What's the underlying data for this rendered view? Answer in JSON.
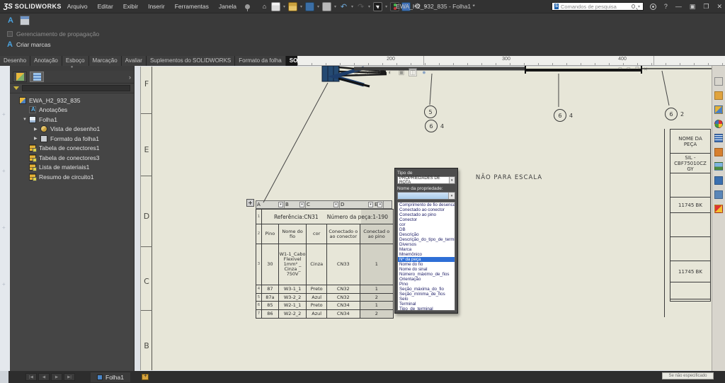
{
  "titlebar": {
    "logo_mark": "ƷS",
    "logo_word": "SOLIDWORKS",
    "menus": [
      "Arquivo",
      "Editar",
      "Exibir",
      "Inserir",
      "Ferramentas",
      "Janela"
    ],
    "title": "EWA_H2_932_835 - Folha1 *",
    "search_placeholder": "Comandos de pesquisa",
    "help_glyph": "?",
    "minimize_glyph": "—",
    "maximize_glyph": "▣",
    "cascade_glyph": "❐",
    "close_glyph": "✕"
  },
  "ribbon": {
    "toggle_label": "Gerenciamento de propagação",
    "command_label": "Criar marcas",
    "tabs": [
      {
        "label": "Desenho",
        "active": false
      },
      {
        "label": "Anotação",
        "active": false
      },
      {
        "label": "Esboço",
        "active": false
      },
      {
        "label": "Marcação",
        "active": false
      },
      {
        "label": "Avaliar",
        "active": false
      },
      {
        "label": "Suplementos do SOLIDWORKS",
        "active": false
      },
      {
        "label": "Formato da folha",
        "active": false
      },
      {
        "label": "SOLIDWORKS Electrical Drawing",
        "active": true
      }
    ]
  },
  "ruler": {
    "labels": [
      "200",
      "300",
      "400"
    ]
  },
  "panel": {
    "tree": [
      {
        "label": "EWA_H2_932_835",
        "icon": "drawing-doc-icon",
        "indent": 0,
        "arrow": ""
      },
      {
        "label": "Anotações",
        "icon": "annotations-icon",
        "indent": 1,
        "arrow": ""
      },
      {
        "label": "Folha1",
        "icon": "sheet-icon",
        "indent": 1,
        "arrow": "▼"
      },
      {
        "label": "Vista de desenho1",
        "icon": "drawing-view-icon",
        "indent": 2,
        "arrow": "▶"
      },
      {
        "label": "Formato da folha1",
        "icon": "sheet-format-icon",
        "indent": 2,
        "arrow": "▶"
      },
      {
        "label": "Tabela de conectores1",
        "icon": "table-icon",
        "indent": 1,
        "arrow": ""
      },
      {
        "label": "Tabela de conectores3",
        "icon": "table-icon",
        "indent": 1,
        "arrow": ""
      },
      {
        "label": "Lista de materiais1",
        "icon": "table-icon",
        "indent": 1,
        "arrow": ""
      },
      {
        "label": "Resumo de circuito1",
        "icon": "table-icon",
        "indent": 1,
        "arrow": ""
      }
    ]
  },
  "sheet": {
    "zones": [
      "F",
      "E",
      "D",
      "C",
      "B"
    ],
    "note": "NÃO PARA ESCALA",
    "balloons": [
      {
        "num": "5",
        "side": ""
      },
      {
        "num": "6",
        "side": "4"
      },
      {
        "num": "6",
        "side": "4"
      },
      {
        "num": "6",
        "side": "2"
      }
    ],
    "parts_rows": [
      "NOME DA PEÇA",
      "SIL - CBF75010CZ GY",
      "",
      "11745 BK",
      "",
      "",
      "11745 BK",
      "",
      ""
    ]
  },
  "ctable": {
    "letters": [
      "A",
      "B",
      "C",
      "D",
      "E"
    ],
    "row_nums": [
      "1",
      "2",
      "3"
    ],
    "ref": "Referência:CN31",
    "part": "Número da peça:1-190",
    "headers": [
      "Pino",
      "Nome do fio",
      "cor",
      "Conectado o ao conector",
      "Conectad o ao pino"
    ],
    "wide": {
      "pino": "30",
      "nome": "W1-1_Cabo Flexivel 1mm² _ Cinza _ 750V",
      "cor": "Cinza",
      "conector": "CN33",
      "pin": "1"
    },
    "rows": [
      {
        "n": "4",
        "pino": "87",
        "nome": "W3-1_1",
        "cor": "Preto",
        "conector": "CN32",
        "pin": "1"
      },
      {
        "n": "5",
        "pino": "87a",
        "nome": "W3-2_2",
        "cor": "Azul",
        "conector": "CN32",
        "pin": "2"
      },
      {
        "n": "6",
        "pino": "85",
        "nome": "W2-1_1",
        "cor": "Preto",
        "conector": "CN34",
        "pin": "1"
      },
      {
        "n": "7",
        "pino": "86",
        "nome": "W2-2_2",
        "cor": "Azul",
        "conector": "CN34",
        "pin": "2"
      }
    ]
  },
  "popup": {
    "type_label": "Tipo de",
    "type_value": "PROPRIEDADES DE ROTA",
    "name_label": "Nome da propriedade:",
    "options": [
      "Comprimento de fio desenca",
      "Conectado ao conector",
      "Conectado ao pino",
      "Conector",
      "cor",
      "DB",
      "Descrição",
      "Descrição_do_tipo_de_termin",
      "Diversos",
      "Marca",
      "Mnemônico",
      "Nº da peça",
      "Nome do fio",
      "Nome do sinal",
      "Número_máximo_de_fios",
      "Orientação",
      "Pino",
      "Seção_máxima_do_fio",
      "Seção_mínima_de_fios",
      "Selo",
      "Terminal",
      "Tipo_de_terminal"
    ],
    "selected": "Nº da peça"
  },
  "status": {
    "sheet_tab": "Folha1",
    "right_text": "Se não especificado"
  },
  "colors": {
    "accent_blue": "#4aa3e0",
    "selection_blue": "#2e6fd6",
    "sheet_beige": "#e7e6d8",
    "panel_grey": "#454545"
  }
}
